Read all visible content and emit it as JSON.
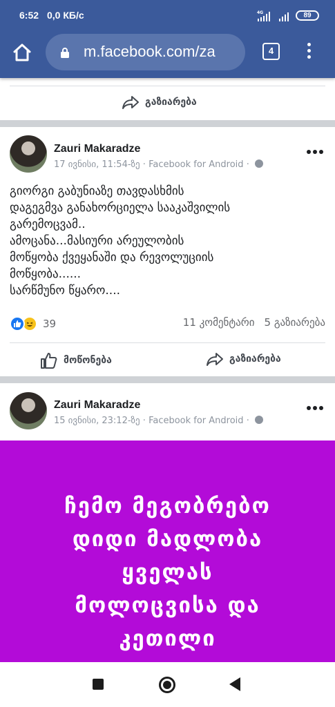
{
  "status_bar": {
    "time": "6:52",
    "network_speed": "0,0 КБ/с",
    "signal_label": "4G",
    "battery": "89"
  },
  "browser": {
    "url": "m.facebook.com/za",
    "tab_count": "4"
  },
  "previous_post": {
    "share_label": "გაზიარება"
  },
  "post1": {
    "author": "Zauri Makaradze",
    "date": "17 ივნისი, 11:54-ზე",
    "separator": "·",
    "app": "Facebook for Android",
    "text_lines": [
      "გიორგი გაბუნიაზე თავდასხმის",
      "დაგეგმვა განახორციელა სააკაშვილის",
      "გარემოცვამ..",
      "ამოცანა...მასიური არეულობის",
      "მოწყობა ქვეყანაში და რევოლუციის",
      "მოწყობა......",
      "სარწმუნო წყარო...."
    ],
    "reaction_count": "39",
    "comments": "11 კომენტარი",
    "shares": "5 გაზიარება",
    "like_label": "მოწონება",
    "share_label": "გაზიარება"
  },
  "post2": {
    "author": "Zauri Makaradze",
    "date": "15 ივნისი, 23:12-ზე",
    "separator": "·",
    "app": "Facebook for Android",
    "image_text_lines": [
      "ჩემო მეგობრებო",
      "დიდი მადლობა",
      "ყველას",
      "მოლოცვისა და",
      "კეთილი"
    ],
    "image_color": "#b30bd8"
  },
  "colors": {
    "header": "#3b5a9b",
    "reaction_like": "#1877f2",
    "reaction_haha": "#f7c21b"
  },
  "icons": [
    "home-icon",
    "lock-icon",
    "tabs-icon",
    "more-vert-icon",
    "share-icon",
    "like-icon",
    "globe-icon",
    "more-horiz-icon",
    "recents-icon",
    "home-nav-icon",
    "back-icon"
  ]
}
